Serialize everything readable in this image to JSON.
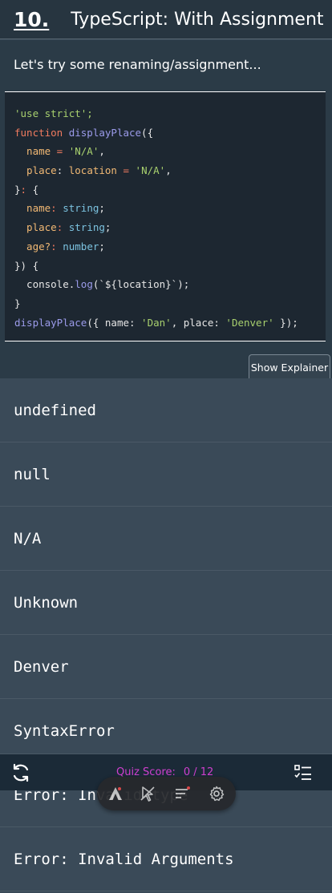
{
  "header": {
    "number": "10.",
    "title": "TypeScript: With Assignment"
  },
  "prompt": "Let's try some renaming/assignment...",
  "code": [
    [
      {
        "t": "'use strict';",
        "c": "c-str"
      }
    ],
    [
      {
        "t": "function ",
        "c": "c-kw"
      },
      {
        "t": "displayPlace",
        "c": "c-fn"
      },
      {
        "t": "({",
        "c": "c-plain"
      }
    ],
    [
      {
        "t": "  name",
        "c": "c-prop"
      },
      {
        "t": " = ",
        "c": "c-kw"
      },
      {
        "t": "'N/A'",
        "c": "c-str"
      },
      {
        "t": ",",
        "c": "c-plain"
      }
    ],
    [
      {
        "t": "  place",
        "c": "c-prop"
      },
      {
        "t": ": ",
        "c": "c-plain"
      },
      {
        "t": "location",
        "c": "c-prop"
      },
      {
        "t": " = ",
        "c": "c-kw"
      },
      {
        "t": "'N/A'",
        "c": "c-str"
      },
      {
        "t": ",",
        "c": "c-plain"
      }
    ],
    [
      {
        "t": "}",
        "c": "c-plain"
      },
      {
        "t": ": ",
        "c": "c-kw"
      },
      {
        "t": "{",
        "c": "c-plain"
      }
    ],
    [
      {
        "t": "  name",
        "c": "c-prop"
      },
      {
        "t": ": ",
        "c": "c-kw"
      },
      {
        "t": "string",
        "c": "c-type"
      },
      {
        "t": ";",
        "c": "c-plain"
      }
    ],
    [
      {
        "t": "  place",
        "c": "c-prop"
      },
      {
        "t": ": ",
        "c": "c-kw"
      },
      {
        "t": "string",
        "c": "c-type"
      },
      {
        "t": ";",
        "c": "c-plain"
      }
    ],
    [
      {
        "t": "  age?",
        "c": "c-prop"
      },
      {
        "t": ": ",
        "c": "c-kw"
      },
      {
        "t": "number",
        "c": "c-type"
      },
      {
        "t": ";",
        "c": "c-plain"
      }
    ],
    [
      {
        "t": "}) {",
        "c": "c-plain"
      }
    ],
    [
      {
        "t": "  console.",
        "c": "c-plain"
      },
      {
        "t": "log",
        "c": "c-fn"
      },
      {
        "t": "(",
        "c": "c-plain"
      },
      {
        "t": "`${location}`",
        "c": "c-plain"
      },
      {
        "t": ");",
        "c": "c-plain"
      }
    ],
    [
      {
        "t": "}",
        "c": "c-plain"
      }
    ],
    [
      {
        "t": "displayPlace",
        "c": "c-fn"
      },
      {
        "t": "({ name: ",
        "c": "c-plain"
      },
      {
        "t": "'Dan'",
        "c": "c-str"
      },
      {
        "t": ", place: ",
        "c": "c-plain"
      },
      {
        "t": "'Denver'",
        "c": "c-str"
      },
      {
        "t": " });",
        "c": "c-plain"
      }
    ]
  ],
  "explainer_label": "Show Explainer",
  "answers": [
    "undefined",
    "null",
    "N/A",
    "Unknown",
    "Denver",
    "SyntaxError",
    "Error: Invalid type",
    "Error: Invalid Arguments"
  ],
  "footer": {
    "score_label": "Quiz Score:",
    "score_value": "0 / 12"
  },
  "colors": {
    "score": "#d13fcf",
    "code_bg": "#1d2731",
    "answer_bg": "#3a4a58"
  },
  "icons": [
    "refresh-icon",
    "checklist-icon",
    "logo-icon",
    "cursor-icon",
    "filter-icon",
    "gear-icon"
  ]
}
